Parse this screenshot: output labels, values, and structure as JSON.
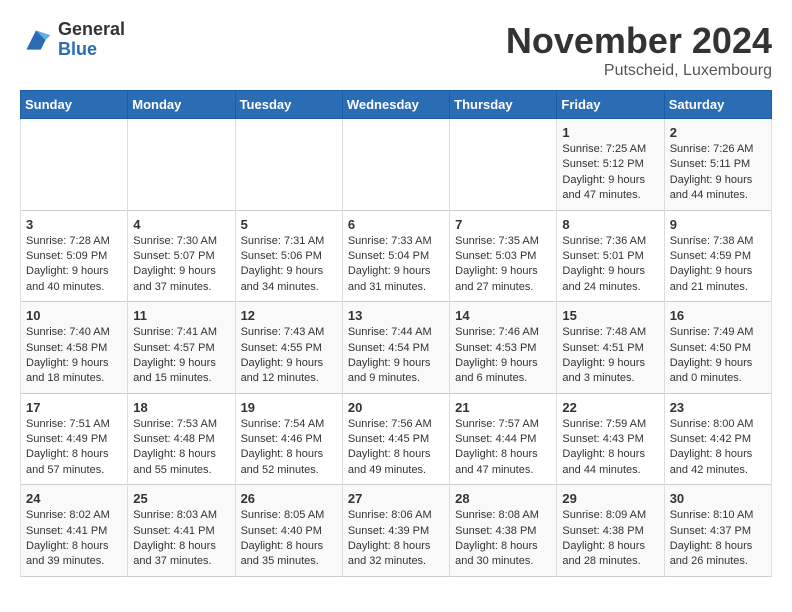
{
  "header": {
    "logo_general": "General",
    "logo_blue": "Blue",
    "month_title": "November 2024",
    "subtitle": "Putscheid, Luxembourg"
  },
  "days_of_week": [
    "Sunday",
    "Monday",
    "Tuesday",
    "Wednesday",
    "Thursday",
    "Friday",
    "Saturday"
  ],
  "weeks": [
    [
      {
        "day": "",
        "info": ""
      },
      {
        "day": "",
        "info": ""
      },
      {
        "day": "",
        "info": ""
      },
      {
        "day": "",
        "info": ""
      },
      {
        "day": "",
        "info": ""
      },
      {
        "day": "1",
        "info": "Sunrise: 7:25 AM\nSunset: 5:12 PM\nDaylight: 9 hours and 47 minutes."
      },
      {
        "day": "2",
        "info": "Sunrise: 7:26 AM\nSunset: 5:11 PM\nDaylight: 9 hours and 44 minutes."
      }
    ],
    [
      {
        "day": "3",
        "info": "Sunrise: 7:28 AM\nSunset: 5:09 PM\nDaylight: 9 hours and 40 minutes."
      },
      {
        "day": "4",
        "info": "Sunrise: 7:30 AM\nSunset: 5:07 PM\nDaylight: 9 hours and 37 minutes."
      },
      {
        "day": "5",
        "info": "Sunrise: 7:31 AM\nSunset: 5:06 PM\nDaylight: 9 hours and 34 minutes."
      },
      {
        "day": "6",
        "info": "Sunrise: 7:33 AM\nSunset: 5:04 PM\nDaylight: 9 hours and 31 minutes."
      },
      {
        "day": "7",
        "info": "Sunrise: 7:35 AM\nSunset: 5:03 PM\nDaylight: 9 hours and 27 minutes."
      },
      {
        "day": "8",
        "info": "Sunrise: 7:36 AM\nSunset: 5:01 PM\nDaylight: 9 hours and 24 minutes."
      },
      {
        "day": "9",
        "info": "Sunrise: 7:38 AM\nSunset: 4:59 PM\nDaylight: 9 hours and 21 minutes."
      }
    ],
    [
      {
        "day": "10",
        "info": "Sunrise: 7:40 AM\nSunset: 4:58 PM\nDaylight: 9 hours and 18 minutes."
      },
      {
        "day": "11",
        "info": "Sunrise: 7:41 AM\nSunset: 4:57 PM\nDaylight: 9 hours and 15 minutes."
      },
      {
        "day": "12",
        "info": "Sunrise: 7:43 AM\nSunset: 4:55 PM\nDaylight: 9 hours and 12 minutes."
      },
      {
        "day": "13",
        "info": "Sunrise: 7:44 AM\nSunset: 4:54 PM\nDaylight: 9 hours and 9 minutes."
      },
      {
        "day": "14",
        "info": "Sunrise: 7:46 AM\nSunset: 4:53 PM\nDaylight: 9 hours and 6 minutes."
      },
      {
        "day": "15",
        "info": "Sunrise: 7:48 AM\nSunset: 4:51 PM\nDaylight: 9 hours and 3 minutes."
      },
      {
        "day": "16",
        "info": "Sunrise: 7:49 AM\nSunset: 4:50 PM\nDaylight: 9 hours and 0 minutes."
      }
    ],
    [
      {
        "day": "17",
        "info": "Sunrise: 7:51 AM\nSunset: 4:49 PM\nDaylight: 8 hours and 57 minutes."
      },
      {
        "day": "18",
        "info": "Sunrise: 7:53 AM\nSunset: 4:48 PM\nDaylight: 8 hours and 55 minutes."
      },
      {
        "day": "19",
        "info": "Sunrise: 7:54 AM\nSunset: 4:46 PM\nDaylight: 8 hours and 52 minutes."
      },
      {
        "day": "20",
        "info": "Sunrise: 7:56 AM\nSunset: 4:45 PM\nDaylight: 8 hours and 49 minutes."
      },
      {
        "day": "21",
        "info": "Sunrise: 7:57 AM\nSunset: 4:44 PM\nDaylight: 8 hours and 47 minutes."
      },
      {
        "day": "22",
        "info": "Sunrise: 7:59 AM\nSunset: 4:43 PM\nDaylight: 8 hours and 44 minutes."
      },
      {
        "day": "23",
        "info": "Sunrise: 8:00 AM\nSunset: 4:42 PM\nDaylight: 8 hours and 42 minutes."
      }
    ],
    [
      {
        "day": "24",
        "info": "Sunrise: 8:02 AM\nSunset: 4:41 PM\nDaylight: 8 hours and 39 minutes."
      },
      {
        "day": "25",
        "info": "Sunrise: 8:03 AM\nSunset: 4:41 PM\nDaylight: 8 hours and 37 minutes."
      },
      {
        "day": "26",
        "info": "Sunrise: 8:05 AM\nSunset: 4:40 PM\nDaylight: 8 hours and 35 minutes."
      },
      {
        "day": "27",
        "info": "Sunrise: 8:06 AM\nSunset: 4:39 PM\nDaylight: 8 hours and 32 minutes."
      },
      {
        "day": "28",
        "info": "Sunrise: 8:08 AM\nSunset: 4:38 PM\nDaylight: 8 hours and 30 minutes."
      },
      {
        "day": "29",
        "info": "Sunrise: 8:09 AM\nSunset: 4:38 PM\nDaylight: 8 hours and 28 minutes."
      },
      {
        "day": "30",
        "info": "Sunrise: 8:10 AM\nSunset: 4:37 PM\nDaylight: 8 hours and 26 minutes."
      }
    ]
  ]
}
